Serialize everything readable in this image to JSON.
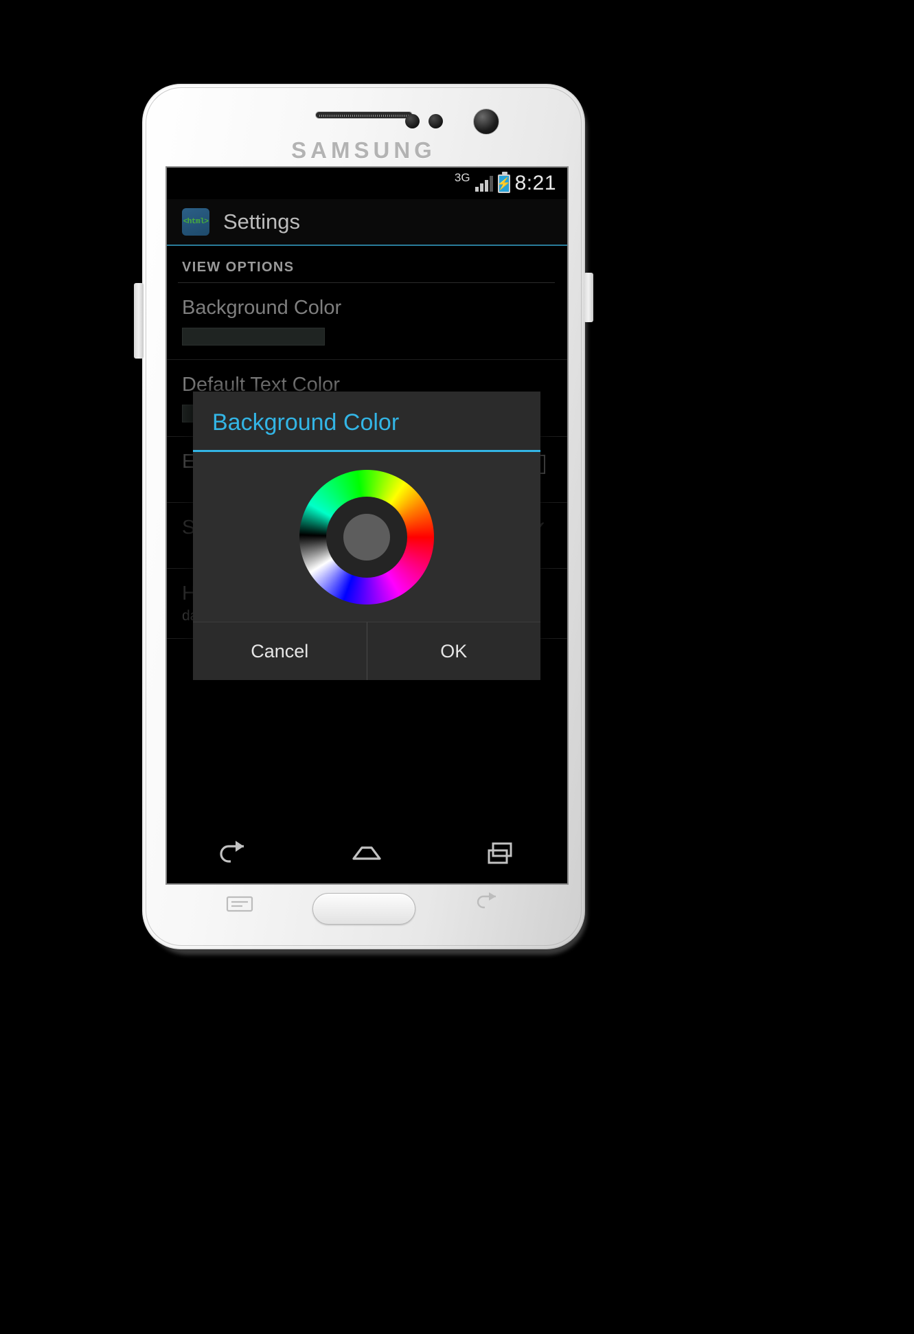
{
  "device": {
    "brand": "SAMSUNG"
  },
  "status_bar": {
    "network": "3G",
    "time": "8:21",
    "battery_icon": "battery-charging-icon",
    "signal_icon": "signal-bars-icon"
  },
  "action_bar": {
    "app_icon_text": "<html>",
    "title": "Settings"
  },
  "content": {
    "section_header": "VIEW OPTIONS",
    "rows": [
      {
        "title": "Background Color",
        "swatch_color": "#1f2422",
        "control": "color-swatch"
      },
      {
        "title": "Default Text Color",
        "control": "color-swatch"
      },
      {
        "title": "Enable Highlighter",
        "control": "checkbox",
        "checked": false
      },
      {
        "title": "Show Line Numbers",
        "control": "checkmark",
        "checked": true
      },
      {
        "title": "Highlighting Theme",
        "subtitle": "darkness",
        "control": "none"
      }
    ]
  },
  "dialog": {
    "title": "Background Color",
    "accent_color": "#33b5e5",
    "picker": "color-wheel",
    "cancel_label": "Cancel",
    "ok_label": "OK"
  },
  "nav_bar": {
    "back": "back-icon",
    "home": "home-icon",
    "recents": "recents-icon"
  }
}
